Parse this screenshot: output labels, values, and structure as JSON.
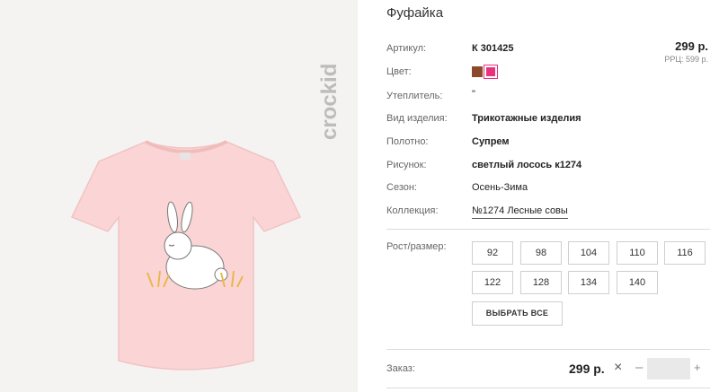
{
  "brand": {
    "logo_text": "crockid"
  },
  "product": {
    "title": "Фуфайка",
    "price": "299 р.",
    "rrp": "РРЦ: 599 р."
  },
  "attributes": [
    {
      "label": "Артикул:",
      "value": "К 301425"
    },
    {
      "label": "Цвет:",
      "value": ""
    },
    {
      "label": "Утеплитель:",
      "value": "\""
    },
    {
      "label": "Вид изделия:",
      "value": "Трикотажные изделия"
    },
    {
      "label": "Полотно:",
      "value": "Супрем"
    },
    {
      "label": "Рисунок:",
      "value": "светлый лосось к1274"
    },
    {
      "label": "Сезон:",
      "value": "Осень-Зима"
    },
    {
      "label": "Коллекция:",
      "value": "№1274 Лесные совы"
    }
  ],
  "colors": [
    "#8b4a2b",
    "#e8327d"
  ],
  "sizes": {
    "label": "Рост/размер:",
    "options": [
      "92",
      "98",
      "104",
      "110",
      "116",
      "122",
      "128",
      "134",
      "140"
    ],
    "select_all": "ВЫБРАТЬ ВСЕ"
  },
  "order": {
    "label": "Заказ:",
    "price": "299 р.",
    "remove": "×",
    "minus": "–",
    "plus": "+",
    "quantity": ""
  }
}
